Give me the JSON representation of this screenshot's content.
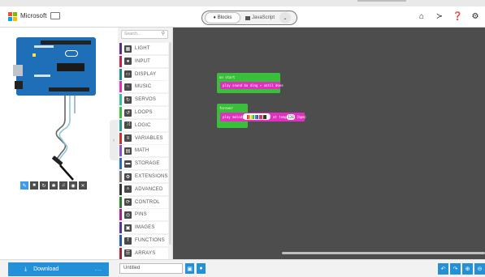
{
  "header": {
    "brand": "Microsoft",
    "toggle": {
      "blocks_label": "Blocks",
      "javascript_label": "JavaScript"
    },
    "icons": [
      "home-icon",
      "share-icon",
      "help-icon",
      "settings-icon"
    ]
  },
  "toolbox": {
    "search_placeholder": "Search...",
    "categories": [
      {
        "label": "LIGHT",
        "color": "#5c2d91",
        "icon": "grid-icon"
      },
      {
        "label": "INPUT",
        "color": "#c0264b",
        "icon": "circle-icon"
      },
      {
        "label": "DISPLAY",
        "color": "#1f8c8c",
        "icon": "monitor-icon"
      },
      {
        "label": "MUSIC",
        "color": "#e12fbf",
        "icon": "headphones-icon"
      },
      {
        "label": "SERVOS",
        "color": "#3abfa2",
        "icon": "refresh-icon"
      },
      {
        "label": "LOOPS",
        "color": "#3abf3a",
        "icon": "loop-icon"
      },
      {
        "label": "LOGIC",
        "color": "#2aa198",
        "icon": "shuffle-icon"
      },
      {
        "label": "VARIABLES",
        "color": "#c9332c",
        "icon": "list-icon"
      },
      {
        "label": "MATH",
        "color": "#8854d0",
        "icon": "calculator-icon"
      },
      {
        "label": "STORAGE",
        "color": "#2d6fb5",
        "icon": "folder-icon"
      },
      {
        "label": "EXTENSIONS",
        "color": "#777777",
        "icon": "gear-icon"
      },
      {
        "label": "ADVANCED",
        "color": "#333333",
        "icon": "chevron-up-icon"
      },
      {
        "label": "CONTROL",
        "color": "#2d7d2d",
        "icon": "cycle-icon"
      },
      {
        "label": "PINS",
        "color": "#a3238f",
        "icon": "target-icon"
      },
      {
        "label": "IMAGES",
        "color": "#5a3796",
        "icon": "image-icon"
      },
      {
        "label": "FUNCTIONS",
        "color": "#2a5aa8",
        "icon": "function-icon"
      },
      {
        "label": "ARRAYS",
        "color": "#9c2a3a",
        "icon": "arrays-icon"
      }
    ]
  },
  "workspace": {
    "on_start": {
      "label": "on start",
      "statement": "play sound ba ding ▾ until done"
    },
    "forever": {
      "label": "forever",
      "statement_prefix": "play melody",
      "statement_mid": "at tempo",
      "tempo": "120",
      "statement_suffix": "(bpm)"
    }
  },
  "bottom": {
    "download_label": "Download",
    "more_label": "...",
    "project_name": "Untitled"
  },
  "colors": {
    "accent": "#2490d8",
    "workspace_bg": "#4d4d4d",
    "green_block": "#3abf3a",
    "magenta_block": "#e12fbf"
  }
}
